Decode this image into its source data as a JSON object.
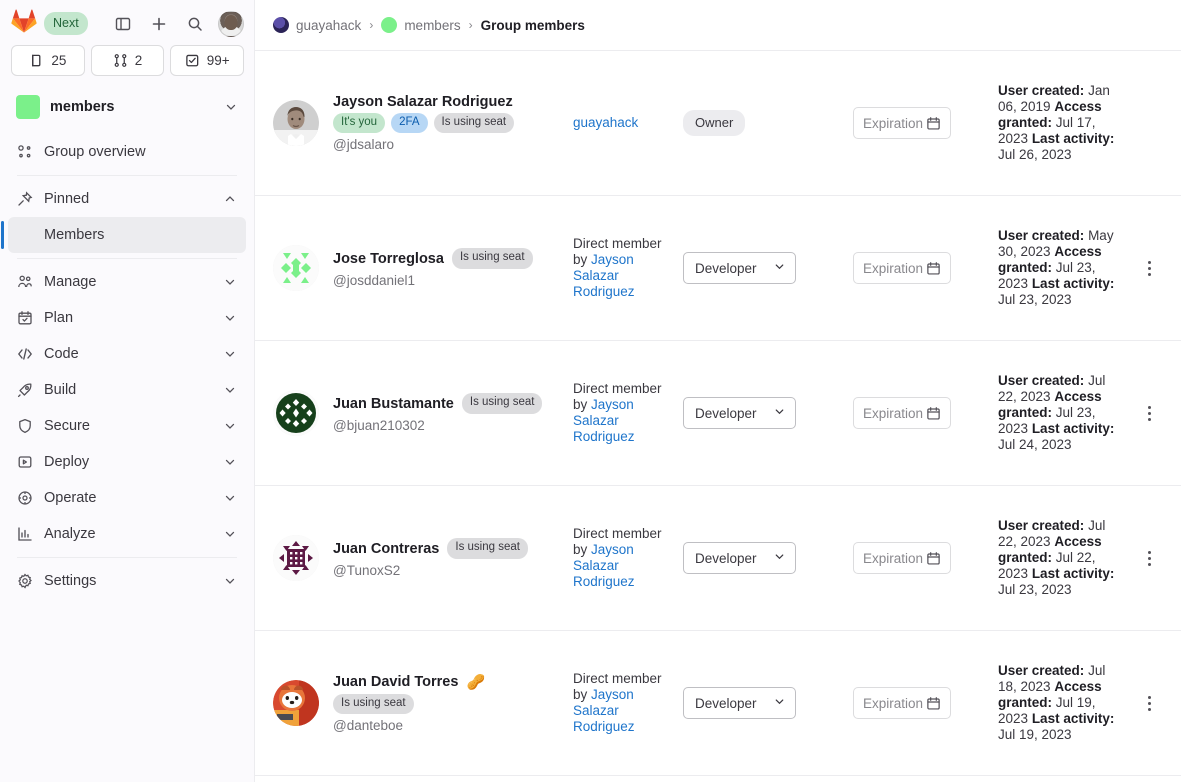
{
  "sidebar": {
    "brand": {
      "logo_icon": "gitlab-logo-icon",
      "next_badge": "Next"
    },
    "top_icons": [
      {
        "name": "toggle-sidebar-icon",
        "label": "Toggle sidebar"
      },
      {
        "name": "create-new-icon",
        "label": "Create new"
      },
      {
        "name": "search-icon",
        "label": "Search"
      }
    ],
    "user_avatar": "user-avatar",
    "counts": [
      {
        "icon": "merge-request-icon",
        "value": "25"
      },
      {
        "icon": "merge-requests-icon",
        "value": "2"
      },
      {
        "icon": "todo-check-icon",
        "value": "99+"
      }
    ],
    "group": {
      "name": "members",
      "color": "#7bf08a",
      "chevron": "chevron-down-icon"
    },
    "items": [
      {
        "label": "Group overview",
        "icon": "group-overview-icon",
        "expandable": false,
        "active": false
      },
      {
        "label": "Pinned",
        "icon": "pin-icon",
        "expandable": true,
        "expanded": true,
        "active": false
      },
      {
        "label": "Members",
        "icon": null,
        "sub": true,
        "active": true
      },
      {
        "label": "Manage",
        "icon": "users-icon",
        "expandable": true,
        "active": false
      },
      {
        "label": "Plan",
        "icon": "calendar-icon",
        "expandable": true,
        "active": false
      },
      {
        "label": "Code",
        "icon": "code-icon",
        "expandable": true,
        "active": false
      },
      {
        "label": "Build",
        "icon": "rocket-icon",
        "expandable": true,
        "active": false
      },
      {
        "label": "Secure",
        "icon": "shield-icon",
        "expandable": true,
        "active": false
      },
      {
        "label": "Deploy",
        "icon": "deploy-icon",
        "expandable": true,
        "active": false
      },
      {
        "label": "Operate",
        "icon": "cloud-gear-icon",
        "expandable": true,
        "active": false
      },
      {
        "label": "Analyze",
        "icon": "chart-icon",
        "expandable": true,
        "active": false
      },
      {
        "label": "Settings",
        "icon": "gear-icon",
        "expandable": true,
        "active": false
      }
    ]
  },
  "breadcrumb": {
    "items": [
      {
        "label": "guayahack",
        "avatar": "project-avatar",
        "current": false
      },
      {
        "label": "members",
        "avatar": "group-avatar",
        "current": false
      },
      {
        "label": "Group members",
        "avatar": null,
        "current": true
      }
    ],
    "separator": "›"
  },
  "members": {
    "expiration_placeholder": "Expiration date",
    "calendar_icon": "calendar-icon",
    "kebab_icon": "ellipsis-vertical-icon",
    "rows": [
      {
        "name": "Jayson Salazar Rodriguez",
        "emoji": "",
        "handle": "@jdsalaro",
        "badges": [
          {
            "text": "It's you",
            "style": "you"
          },
          {
            "text": "2FA",
            "style": "2fa"
          },
          {
            "text": "Is using seat",
            "style": "seat"
          }
        ],
        "source_prefix": "",
        "source_link": "guayahack",
        "role_type": "static",
        "role": "Owner",
        "expiration_value": "",
        "user_created_label": "User created:",
        "user_created": "Jan 06, 2019",
        "access_granted_label": "Access granted:",
        "access_granted": "Jul 17, 2023",
        "last_activity_label": "Last activity:",
        "last_activity": "Jul 26, 2023",
        "has_actions": false,
        "avatar_type": "photo-jayson"
      },
      {
        "name": "Jose Torreglosa",
        "emoji": "",
        "handle": "@josddaniel1",
        "badges": [
          {
            "text": "Is using seat",
            "style": "seat"
          }
        ],
        "source_prefix": "Direct member by",
        "source_link": "Jayson Salazar Rodriguez",
        "role_type": "select",
        "role": "Developer",
        "expiration_value": "",
        "user_created_label": "User created:",
        "user_created": "May 30, 2023",
        "access_granted_label": "Access granted:",
        "access_granted": "Jul 23, 2023",
        "last_activity_label": "Last activity:",
        "last_activity": "Jul 23, 2023",
        "has_actions": true,
        "avatar_type": "identicon-green"
      },
      {
        "name": "Juan Bustamante",
        "emoji": "",
        "handle": "@bjuan210302",
        "badges": [
          {
            "text": "Is using seat",
            "style": "seat"
          }
        ],
        "source_prefix": "Direct member by",
        "source_link": "Jayson Salazar Rodriguez",
        "role_type": "select",
        "role": "Developer",
        "expiration_value": "",
        "user_created_label": "User created:",
        "user_created": "Jul 22, 2023",
        "access_granted_label": "Access granted:",
        "access_granted": "Jul 23, 2023",
        "last_activity_label": "Last activity:",
        "last_activity": "Jul 24, 2023",
        "has_actions": true,
        "avatar_type": "identicon-darkgreen"
      },
      {
        "name": "Juan Contreras",
        "emoji": "",
        "handle": "@TunoxS2",
        "badges": [
          {
            "text": "Is using seat",
            "style": "seat"
          }
        ],
        "source_prefix": "Direct member by",
        "source_link": "Jayson Salazar Rodriguez",
        "role_type": "select",
        "role": "Developer",
        "expiration_value": "",
        "user_created_label": "User created:",
        "user_created": "Jul 22, 2023",
        "access_granted_label": "Access granted:",
        "access_granted": "Jul 22, 2023",
        "last_activity_label": "Last activity:",
        "last_activity": "Jul 23, 2023",
        "has_actions": true,
        "avatar_type": "identicon-purple"
      },
      {
        "name": "Juan David Torres",
        "emoji": "🥜",
        "handle": "@danteboe",
        "badges": [
          {
            "text": "Is using seat",
            "style": "seat"
          }
        ],
        "source_prefix": "Direct member by",
        "source_link": "Jayson Salazar Rodriguez",
        "role_type": "select",
        "role": "Developer",
        "expiration_value": "",
        "user_created_label": "User created:",
        "user_created": "Jul 18, 2023",
        "access_granted_label": "Access granted:",
        "access_granted": "Jul 19, 2023",
        "last_activity_label": "Last activity:",
        "last_activity": "Jul 19, 2023",
        "has_actions": true,
        "avatar_type": "photo-redpanda"
      }
    ]
  },
  "colors": {
    "accent_link": "#1f75cb",
    "badge_green_bg": "#c3e6cd",
    "badge_blue_bg": "#b7d7f5",
    "badge_gray_bg": "#dcdcde",
    "group_green": "#7bf08a"
  }
}
